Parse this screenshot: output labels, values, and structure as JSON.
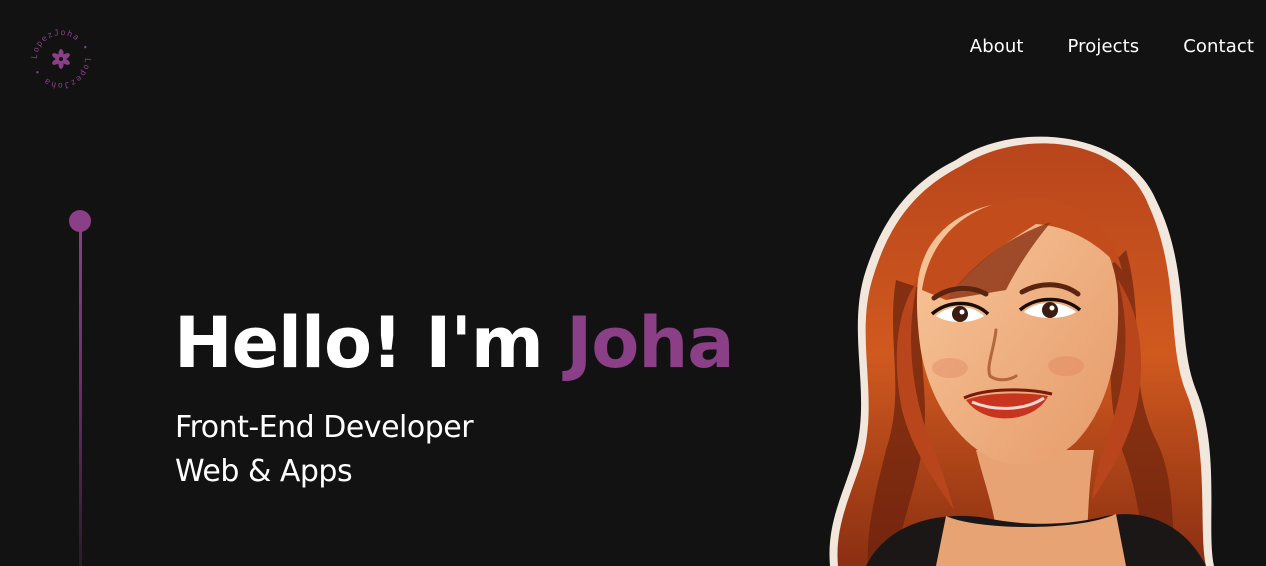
{
  "logo": {
    "ring_text": "LopezJoha • LopezJoha •",
    "icon": "flower-icon",
    "color": "#8a3f86"
  },
  "nav": {
    "items": [
      {
        "label": "About"
      },
      {
        "label": "Projects"
      },
      {
        "label": "Contact"
      }
    ]
  },
  "hero": {
    "greeting": "Hello! I'm ",
    "name": "Joha",
    "subtitle_line1": "Front-End Developer",
    "subtitle_line2": "Web & Apps"
  },
  "colors": {
    "background": "#131213",
    "accent": "#8a3f86",
    "text": "#ffffff"
  },
  "portrait": {
    "icon": "portrait-illustration"
  }
}
